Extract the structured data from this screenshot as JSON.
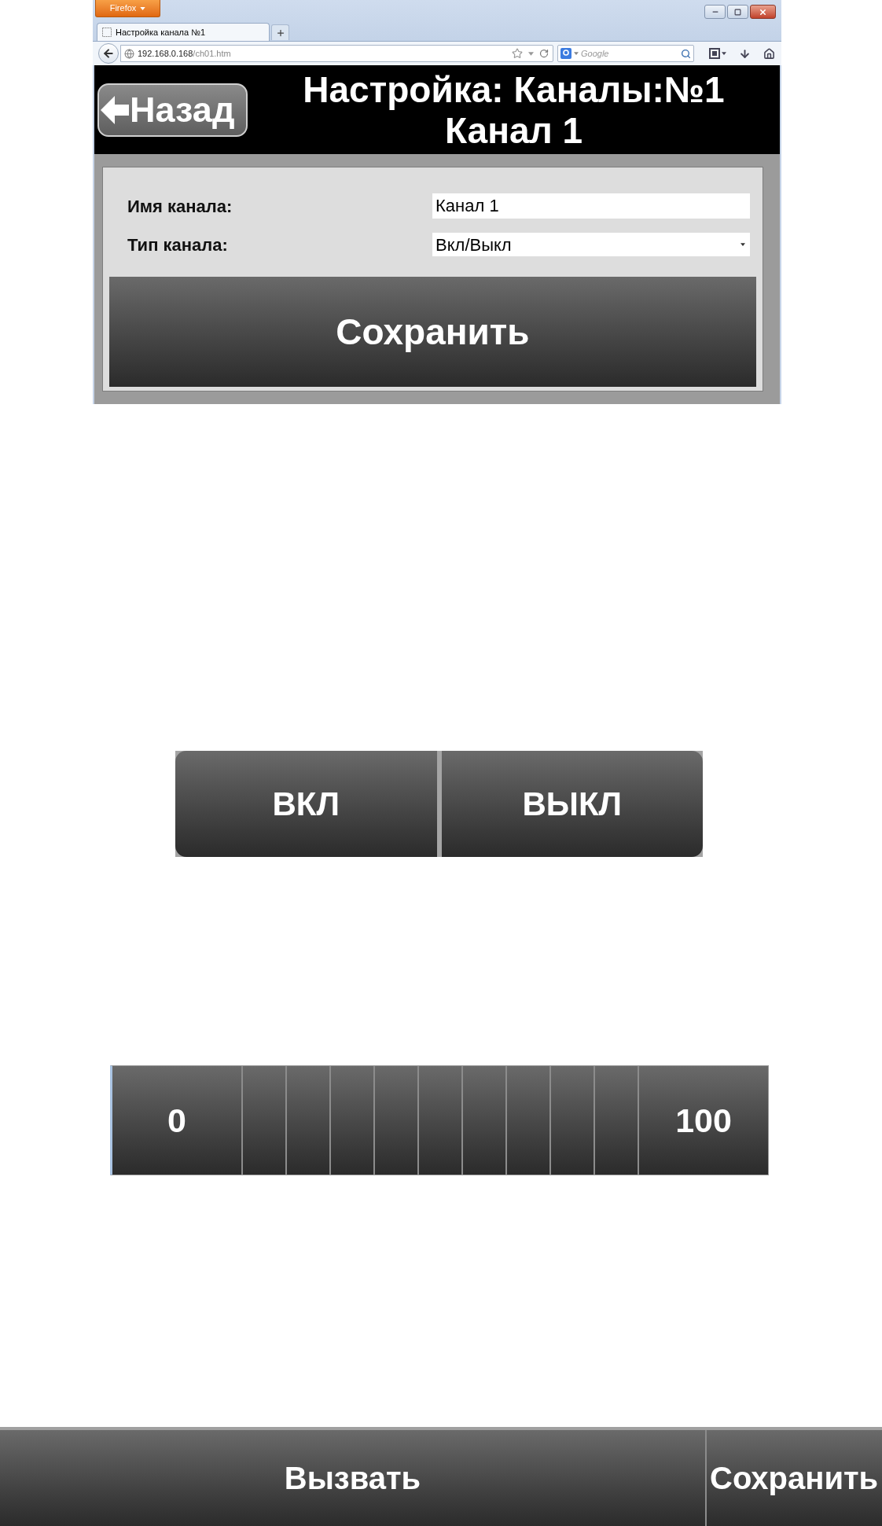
{
  "browser": {
    "menu_button": "Firefox",
    "tabs": [
      {
        "title": "Настройка канала №1",
        "selected": true
      }
    ],
    "address": {
      "host": "192.168.0.168",
      "path": "/ch01.htm"
    },
    "search": {
      "placeholder": "Google"
    }
  },
  "header": {
    "back_button": "Назад",
    "title_lines": [
      "Настройка: Каналы:№1",
      "Канал 1"
    ]
  },
  "form": {
    "fields": [
      {
        "kind": "text",
        "label": "Имя канала:",
        "value": "Канал 1"
      },
      {
        "kind": "select",
        "label": "Тип канала:",
        "value": "Вкл/Выкл"
      }
    ],
    "save_button": "Сохранить"
  },
  "toggle": {
    "buttons": [
      "ВКЛ",
      "ВЫКЛ"
    ]
  },
  "scale": {
    "cells": [
      {
        "kind": "label",
        "label": "0"
      },
      {
        "kind": "step"
      },
      {
        "kind": "step"
      },
      {
        "kind": "step"
      },
      {
        "kind": "step"
      },
      {
        "kind": "step"
      },
      {
        "kind": "step"
      },
      {
        "kind": "step"
      },
      {
        "kind": "step"
      },
      {
        "kind": "step"
      },
      {
        "kind": "label",
        "label": "100"
      }
    ]
  },
  "bottom_bar": {
    "buttons": [
      "Вызвать",
      "Сохранить"
    ]
  }
}
